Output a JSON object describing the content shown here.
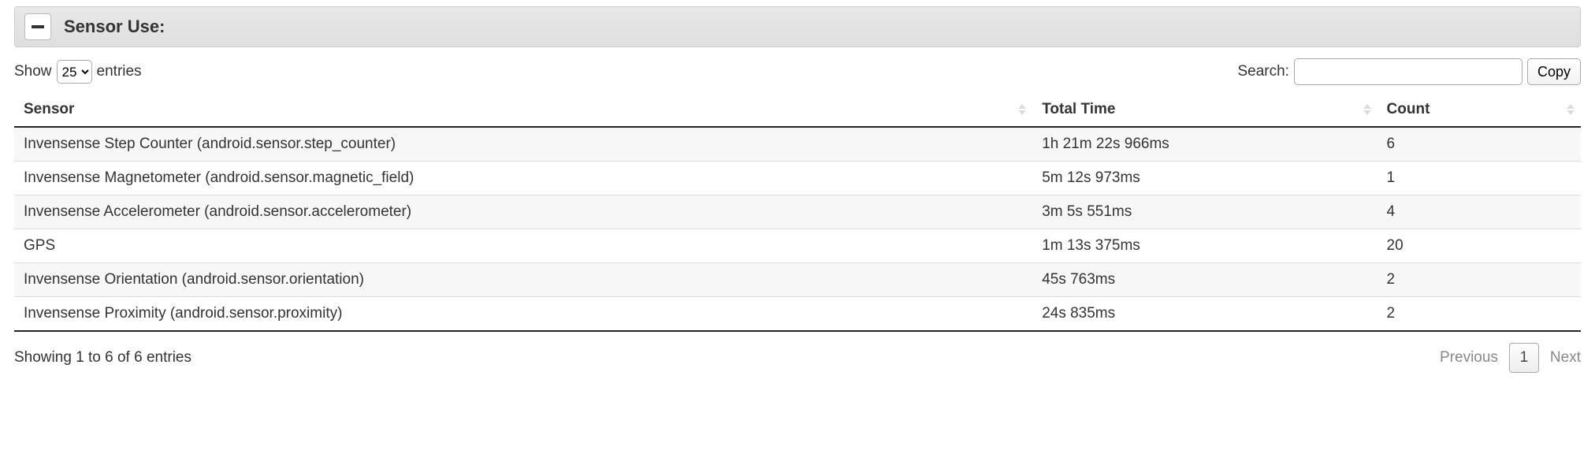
{
  "panel": {
    "title": "Sensor Use:"
  },
  "controls": {
    "show_prefix": "Show",
    "show_suffix": "entries",
    "length_value": "25",
    "search_label": "Search:",
    "search_value": "",
    "copy_label": "Copy"
  },
  "table": {
    "headers": {
      "sensor": "Sensor",
      "total_time": "Total Time",
      "count": "Count"
    },
    "rows": [
      {
        "sensor": "Invensense Step Counter (android.sensor.step_counter)",
        "total_time": "1h 21m 22s 966ms",
        "count": "6"
      },
      {
        "sensor": "Invensense Magnetometer (android.sensor.magnetic_field)",
        "total_time": "5m 12s 973ms",
        "count": "1"
      },
      {
        "sensor": "Invensense Accelerometer (android.sensor.accelerometer)",
        "total_time": "3m 5s 551ms",
        "count": "4"
      },
      {
        "sensor": "GPS",
        "total_time": "1m 13s 375ms",
        "count": "20"
      },
      {
        "sensor": "Invensense Orientation (android.sensor.orientation)",
        "total_time": "45s 763ms",
        "count": "2"
      },
      {
        "sensor": "Invensense Proximity (android.sensor.proximity)",
        "total_time": "24s 835ms",
        "count": "2"
      }
    ]
  },
  "footer": {
    "info": "Showing 1 to 6 of 6 entries",
    "previous": "Previous",
    "next": "Next",
    "page": "1"
  }
}
